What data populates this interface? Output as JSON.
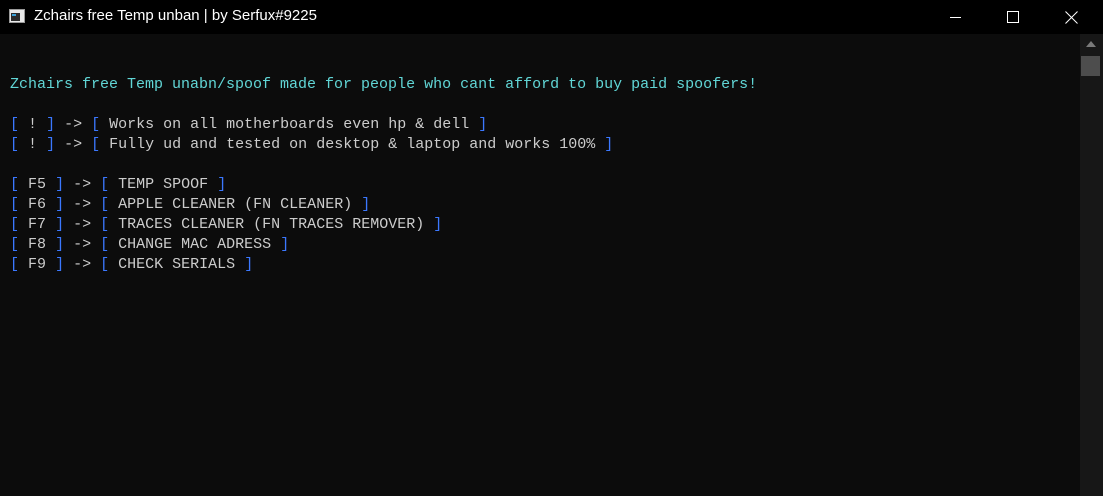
{
  "window": {
    "title": "Zchairs free Temp unban | by Serfux#9225",
    "icon": "console-app-icon"
  },
  "console": {
    "header": "Zchairs free Temp unabn/spoof made for people who cant afford to buy paid spoofers!",
    "notes": [
      {
        "key": "!",
        "text": "Works on all motherboards even hp & dell"
      },
      {
        "key": "!",
        "text": "Fully ud and tested on desktop & laptop and works 100%"
      }
    ],
    "options": [
      {
        "key": "F5",
        "text": "TEMP SPOOF"
      },
      {
        "key": "F6",
        "text": "APPLE CLEANER (FN CLEANER)"
      },
      {
        "key": "F7",
        "text": "TRACES CLEANER (FN TRACES REMOVER)"
      },
      {
        "key": "F8",
        "text": "CHANGE MAC ADRESS"
      },
      {
        "key": "F9",
        "text": "CHECK SERIALS"
      }
    ],
    "arrow": "->",
    "bracket_open": "[",
    "bracket_close": "]"
  },
  "colors": {
    "background": "#0c0c0c",
    "titlebar": "#000000",
    "cyan_text": "#61d6d6",
    "blue_brackets": "#3b78ff",
    "gray_text": "#cccccc"
  }
}
